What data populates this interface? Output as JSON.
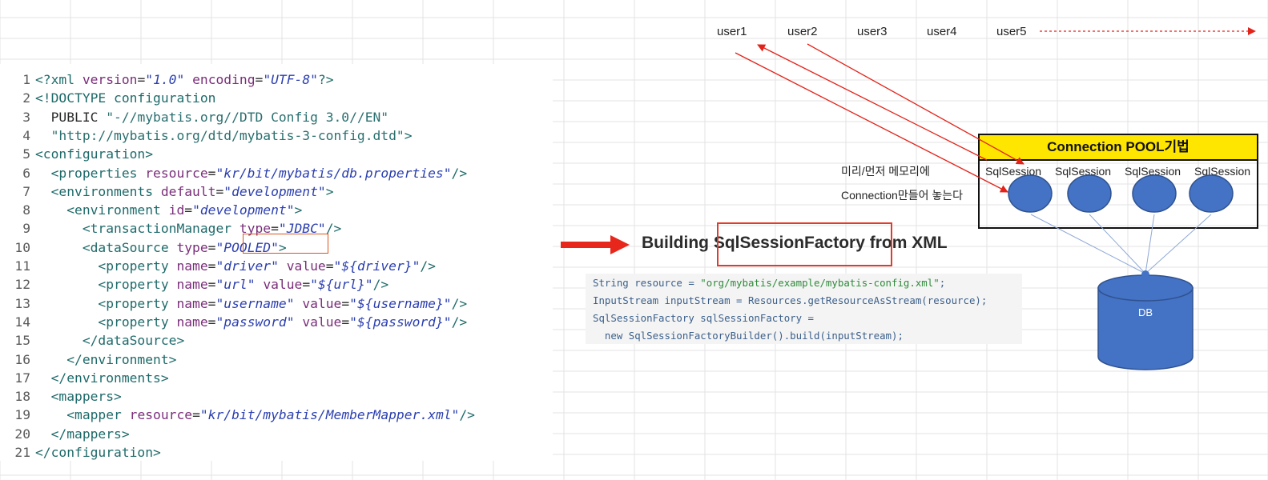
{
  "users": [
    "user1",
    "user2",
    "user3",
    "user4",
    "user5"
  ],
  "code_lines": [
    {
      "n": "1",
      "parts": [
        [
          "t-tag",
          "<?xml "
        ],
        [
          "t-attr",
          "version"
        ],
        [
          "t-plain",
          "="
        ],
        [
          "t-val",
          "\"1.0\""
        ],
        [
          "t-plain",
          " "
        ],
        [
          "t-attr",
          "encoding"
        ],
        [
          "t-plain",
          "="
        ],
        [
          "t-val",
          "\"UTF-8\""
        ],
        [
          "t-tag",
          "?>"
        ]
      ]
    },
    {
      "n": "2",
      "parts": [
        [
          "t-tag",
          "<!DOCTYPE configuration"
        ]
      ]
    },
    {
      "n": "3",
      "parts": [
        [
          "t-plain",
          "  PUBLIC "
        ],
        [
          "t-str",
          "\"-//mybatis.org//DTD Config 3.0//EN\""
        ]
      ]
    },
    {
      "n": "4",
      "parts": [
        [
          "t-str",
          "  \"http://mybatis.org/dtd/mybatis-3-config.dtd\""
        ],
        [
          "t-tag",
          ">"
        ]
      ]
    },
    {
      "n": "5",
      "parts": [
        [
          "t-tag",
          "<configuration>"
        ]
      ]
    },
    {
      "n": "6",
      "parts": [
        [
          "t-tag",
          "  <properties "
        ],
        [
          "t-attr",
          "resource"
        ],
        [
          "t-plain",
          "="
        ],
        [
          "t-val",
          "\"kr/bit/mybatis/db.properties\""
        ],
        [
          "t-tag",
          "/>"
        ]
      ]
    },
    {
      "n": "7",
      "parts": [
        [
          "t-tag",
          "  <environments "
        ],
        [
          "t-attr",
          "default"
        ],
        [
          "t-plain",
          "="
        ],
        [
          "t-val",
          "\"development\""
        ],
        [
          "t-tag",
          ">"
        ]
      ]
    },
    {
      "n": "8",
      "parts": [
        [
          "t-tag",
          "    <environment "
        ],
        [
          "t-attr",
          "id"
        ],
        [
          "t-plain",
          "="
        ],
        [
          "t-val",
          "\"development\""
        ],
        [
          "t-tag",
          ">"
        ]
      ]
    },
    {
      "n": "9",
      "parts": [
        [
          "t-tag",
          "      <transactionManager "
        ],
        [
          "t-attr",
          "type"
        ],
        [
          "t-plain",
          "="
        ],
        [
          "t-val",
          "\"JDBC\""
        ],
        [
          "t-tag",
          "/>"
        ]
      ]
    },
    {
      "n": "10",
      "parts": [
        [
          "t-tag",
          "      <dataSource "
        ],
        [
          "t-attr",
          "type"
        ],
        [
          "t-plain",
          "="
        ],
        [
          "t-val",
          "\"POOLED\""
        ],
        [
          "t-tag",
          ">"
        ]
      ]
    },
    {
      "n": "11",
      "parts": [
        [
          "t-tag",
          "        <property "
        ],
        [
          "t-attr",
          "name"
        ],
        [
          "t-plain",
          "="
        ],
        [
          "t-val",
          "\"driver\""
        ],
        [
          "t-plain",
          " "
        ],
        [
          "t-attr",
          "value"
        ],
        [
          "t-plain",
          "="
        ],
        [
          "t-val",
          "\"${driver}\""
        ],
        [
          "t-tag",
          "/>"
        ]
      ]
    },
    {
      "n": "12",
      "parts": [
        [
          "t-tag",
          "        <property "
        ],
        [
          "t-attr",
          "name"
        ],
        [
          "t-plain",
          "="
        ],
        [
          "t-val",
          "\"url\""
        ],
        [
          "t-plain",
          " "
        ],
        [
          "t-attr",
          "value"
        ],
        [
          "t-plain",
          "="
        ],
        [
          "t-val",
          "\"${url}\""
        ],
        [
          "t-tag",
          "/>"
        ]
      ]
    },
    {
      "n": "13",
      "parts": [
        [
          "t-tag",
          "        <property "
        ],
        [
          "t-attr",
          "name"
        ],
        [
          "t-plain",
          "="
        ],
        [
          "t-val",
          "\"username\""
        ],
        [
          "t-plain",
          " "
        ],
        [
          "t-attr",
          "value"
        ],
        [
          "t-plain",
          "="
        ],
        [
          "t-val",
          "\"${username}\""
        ],
        [
          "t-tag",
          "/>"
        ]
      ]
    },
    {
      "n": "14",
      "parts": [
        [
          "t-tag",
          "        <property "
        ],
        [
          "t-attr",
          "name"
        ],
        [
          "t-plain",
          "="
        ],
        [
          "t-val",
          "\"password\""
        ],
        [
          "t-plain",
          " "
        ],
        [
          "t-attr",
          "value"
        ],
        [
          "t-plain",
          "="
        ],
        [
          "t-val",
          "\"${password}\""
        ],
        [
          "t-tag",
          "/>"
        ]
      ]
    },
    {
      "n": "15",
      "parts": [
        [
          "t-tag",
          "      </dataSource>"
        ]
      ]
    },
    {
      "n": "16",
      "parts": [
        [
          "t-tag",
          "    </environment>"
        ]
      ]
    },
    {
      "n": "17",
      "parts": [
        [
          "t-tag",
          "  </environments>"
        ]
      ]
    },
    {
      "n": "18",
      "parts": [
        [
          "t-tag",
          "  <mappers>"
        ]
      ]
    },
    {
      "n": "19",
      "parts": [
        [
          "t-tag",
          "    <mapper "
        ],
        [
          "t-attr",
          "resource"
        ],
        [
          "t-plain",
          "="
        ],
        [
          "t-val",
          "\"kr/bit/mybatis/MemberMapper.xml\""
        ],
        [
          "t-tag",
          "/>"
        ]
      ]
    },
    {
      "n": "20",
      "parts": [
        [
          "t-tag",
          "  </mappers>"
        ]
      ]
    },
    {
      "n": "21",
      "parts": [
        [
          "t-tag",
          "</configuration>"
        ]
      ]
    }
  ],
  "building": {
    "prefix": "Building ",
    "highlight": "SqlSessionFactory",
    "suffix": " from XML"
  },
  "java_lines": [
    [
      [
        "j-code",
        "String resource = "
      ],
      [
        "j-str",
        "\"org/mybatis/example/mybatis-config.xml\""
      ],
      [
        "j-code",
        ";"
      ]
    ],
    [
      [
        "j-code",
        "InputStream inputStream = Resources.getResourceAsStream(resource);"
      ]
    ],
    [
      [
        "j-code",
        "SqlSessionFactory sqlSessionFactory ="
      ]
    ],
    [
      [
        "j-code",
        "  new SqlSessionFactoryBuilder().build(inputStream);"
      ]
    ]
  ],
  "pool": {
    "title": "Connection POOL기법",
    "sessions": [
      "SqlSession",
      "SqlSession",
      "SqlSession",
      "SqlSession"
    ]
  },
  "korean_note": {
    "line1": "미리/먼저 메모리에",
    "line2": "Connection만들어 놓는다"
  },
  "db_label": "DB",
  "colors": {
    "arrow_red": "#e2231a",
    "pool_yellow": "#ffe600",
    "db_blue": "#4472c4",
    "db_line": "#8fa9d6"
  }
}
